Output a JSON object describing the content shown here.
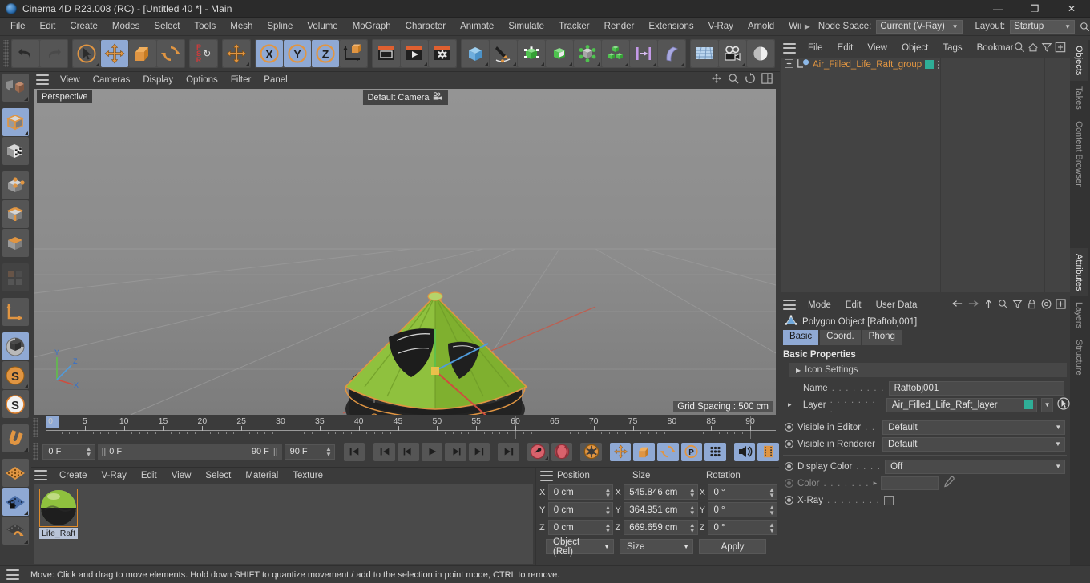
{
  "titlebar": {
    "title": "Cinema 4D R23.008 (RC) - [Untitled 40 *] - Main",
    "minimize": "—",
    "maximize": "❐",
    "close": "✕"
  },
  "menubar": {
    "items": [
      "File",
      "Edit",
      "Create",
      "Modes",
      "Select",
      "Tools",
      "Mesh",
      "Spline",
      "Volume",
      "MoGraph",
      "Character",
      "Animate",
      "Simulate",
      "Tracker",
      "Render",
      "Extensions",
      "V-Ray",
      "Arnold",
      "Wind"
    ],
    "overflow_arrow": "▶",
    "node_space_label": "Node Space:",
    "node_space_value": "Current (V-Ray)",
    "layout_label": "Layout:",
    "layout_value": "Startup"
  },
  "toolbar": {
    "undo": "undo-icon",
    "redo": "redo-icon",
    "select": "live-select-icon",
    "move": "move-icon",
    "scale": "scale-icon",
    "rotate": "rotate-icon",
    "psr": "PSR",
    "psr_sub": "↻",
    "move_world": "move-world-icon",
    "lock_x": "X",
    "lock_y": "Y",
    "lock_z": "Z",
    "world_object": "world-object-icon",
    "render_view": "render-view-icon",
    "render_queue": "render-queue-icon",
    "render_settings": "render-settings-icon",
    "cube": "cube-icon",
    "spline": "pen-spline-icon",
    "nurbs": "generators-icon",
    "boole": "boole-icon",
    "deformer": "deformer-icon",
    "mograph": "mograph-cloner-icon",
    "scene": "scene-icon",
    "field": "field-icon",
    "floor": "floor-icon",
    "camera": "camera-icon",
    "light": "light-icon"
  },
  "left_toolbar": [
    {
      "name": "make-editable-icon",
      "selected": false
    },
    {
      "name": "model-mode-icon",
      "selected": true
    },
    {
      "name": "texture-mode-icon",
      "selected": false
    },
    {
      "name": "point-mode-icon",
      "selected": false
    },
    {
      "name": "edge-mode-icon",
      "selected": false
    },
    {
      "name": "polygon-mode-icon",
      "selected": false
    },
    {
      "name": "uv-mode-icon",
      "selected": false,
      "dim": true
    },
    {
      "name": "axis-modify-icon",
      "selected": false
    },
    {
      "name": "viewport-solo-icon",
      "selected": true
    },
    {
      "name": "enable-axis-icon",
      "selected": true
    },
    {
      "name": "snap-settings-icon",
      "selected": false
    },
    {
      "name": "quantize-icon",
      "selected": false
    },
    {
      "name": "magnet-icon",
      "selected": false
    },
    {
      "name": "workplane-icon",
      "selected": false
    },
    {
      "name": "workplane-lock-icon",
      "selected": true
    },
    {
      "name": "workplane-align-icon",
      "selected": false
    }
  ],
  "viewport": {
    "menu": [
      "View",
      "Cameras",
      "Display",
      "Options",
      "Filter",
      "Panel"
    ],
    "label": "Perspective",
    "camera": "Default Camera",
    "grid_spacing": "Grid Spacing : 500 cm",
    "axis_x": "X",
    "axis_y": "Y",
    "axis_z": "Z"
  },
  "timeline": {
    "ticks": [
      "0",
      "5",
      "10",
      "15",
      "20",
      "25",
      "30",
      "35",
      "40",
      "45",
      "50",
      "55",
      "60",
      "65",
      "70",
      "75",
      "80",
      "85",
      "90"
    ],
    "current_frame": "0 F",
    "range_start": "0 F",
    "range_end": "90 F",
    "doc_end": "90 F",
    "preview_frame": "0 F",
    "buttons": {
      "go_start": "⏮",
      "prev_key": "⏮",
      "prev_frame": "◀",
      "play": "▶",
      "next_frame": "▶",
      "next_key": "⏭",
      "go_end": "⏭",
      "record": "record-keyframe-icon",
      "autokey": "autokeying-icon",
      "keyframe_settings": "keyframe-settings-icon",
      "key_position": "key-position-icon",
      "key_scale": "key-scale-icon",
      "key_rotation": "key-rotation-icon",
      "key_param": "key-parameter-icon",
      "key_pla": "key-pla-icon",
      "sound": "sound-icon",
      "film": "film-icon"
    }
  },
  "material_manager": {
    "menu": [
      "Create",
      "V-Ray",
      "Edit",
      "View",
      "Select",
      "Material",
      "Texture"
    ],
    "materials": [
      {
        "name": "Life_Raft"
      }
    ]
  },
  "coordinates": {
    "headers": [
      "Position",
      "Size",
      "Rotation"
    ],
    "axes": [
      "X",
      "Y",
      "Z"
    ],
    "position": [
      "0 cm",
      "0 cm",
      "0 cm"
    ],
    "size": [
      "545.846 cm",
      "364.951 cm",
      "669.659 cm"
    ],
    "rotation": [
      "0 °",
      "0 °",
      "0 °"
    ],
    "mode": "Object (Rel)",
    "size_mode": "Size",
    "apply": "Apply"
  },
  "object_manager": {
    "menu": [
      "File",
      "Edit",
      "View",
      "Object",
      "Tags",
      "Bookmarks"
    ],
    "tools": [
      "search-icon",
      "home-icon",
      "filter-icon",
      "add-icon"
    ],
    "objects": [
      {
        "name": "Air_Filled_Life_Raft_group",
        "layer_color": "#2fae97"
      }
    ]
  },
  "attributes": {
    "menu": [
      "Mode",
      "Edit",
      "User Data"
    ],
    "tools": [
      "back-arrow-icon",
      "forward-arrow-icon",
      "up-arrow-icon",
      "search-icon",
      "filter-icon",
      "lock-icon",
      "target-icon",
      "add-icon"
    ],
    "object_title": "Polygon Object [Raftobj001]",
    "tabs": [
      "Basic",
      "Coord.",
      "Phong"
    ],
    "active_tab": "Basic",
    "section_title": "Basic Properties",
    "icon_settings": "Icon Settings",
    "rows": {
      "name_label": "Name",
      "name_value": "Raftobj001",
      "layer_label": "Layer",
      "layer_value": "Air_Filled_Life_Raft_layer",
      "layer_color": "#2fae97",
      "visible_editor_label": "Visible in Editor",
      "visible_editor_value": "Default",
      "visible_renderer_label": "Visible in Renderer",
      "visible_renderer_value": "Default",
      "display_color_label": "Display Color",
      "display_color_value": "Off",
      "color_label": "Color",
      "xray_label": "X-Ray"
    },
    "dots": ". . . . . . . ."
  },
  "vtabs_top": [
    "Objects",
    "Takes",
    "Content Browser"
  ],
  "vtabs_bottom": [
    "Attributes",
    "Layers",
    "Structure"
  ],
  "statusbar": {
    "text": "Move: Click and drag to move elements. Hold down SHIFT to quantize movement / add to the selection in point mode, CTRL to remove."
  },
  "colors": {
    "accent_blue": "#8fa9d4",
    "orange": "#e09542",
    "teal": "#2fae97",
    "panel_bg": "#3b3b3b"
  }
}
